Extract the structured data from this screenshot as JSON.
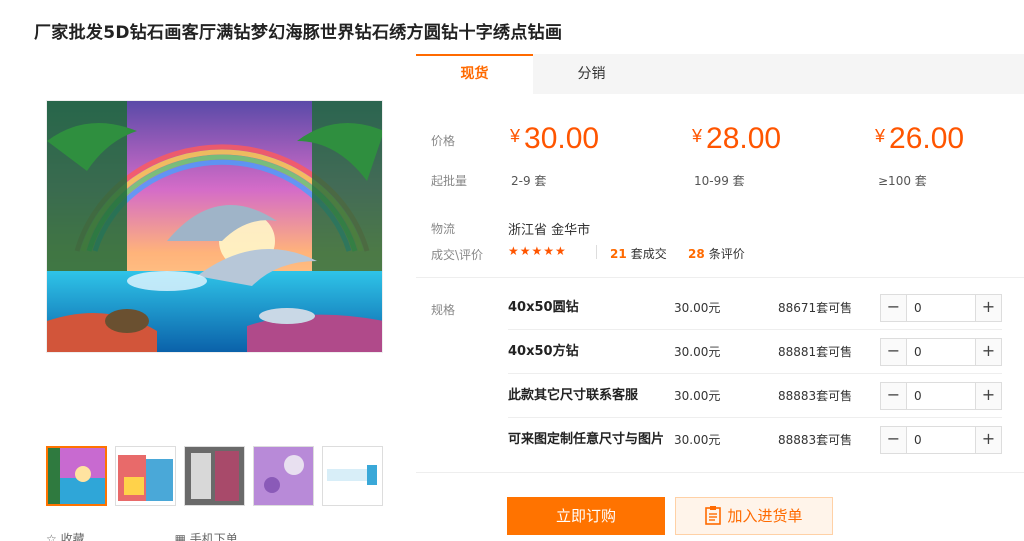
{
  "product": {
    "title": "厂家批发5D钻石画客厅满钻梦幻海豚世界钻石绣方圆钻十字绣点钻画"
  },
  "gallery": {
    "bottom_links": [
      "收藏",
      "手机下单"
    ]
  },
  "tabs": [
    {
      "label": "现货"
    },
    {
      "label": "分销"
    }
  ],
  "pricing": {
    "price_label": "价格",
    "moq_label": "起批量",
    "currency": "¥",
    "tiers": [
      {
        "price": "30.00",
        "range": "2-9 套"
      },
      {
        "price": "28.00",
        "range": "10-99 套"
      },
      {
        "price": "26.00",
        "range": "≥100 套"
      }
    ]
  },
  "logistics": {
    "label": "物流",
    "value": "浙江省 金华市"
  },
  "reviews": {
    "label": "成交\\评价",
    "stars": "★★★★★",
    "deals_count": "21",
    "deals_suffix": "套成交",
    "reviews_count": "28",
    "reviews_suffix": "条评价"
  },
  "specs": {
    "label": "规格",
    "rows": [
      {
        "name": "40x50圆钻",
        "price": "30.00元",
        "stock": "88671套可售",
        "qty": "0"
      },
      {
        "name": "40x50方钻",
        "price": "30.00元",
        "stock": "88881套可售",
        "qty": "0"
      },
      {
        "name": "此款其它尺寸联系客服",
        "price": "30.00元",
        "stock": "88883套可售",
        "qty": "0"
      },
      {
        "name": "可来图定制任意尺寸与图片",
        "price": "30.00元",
        "stock": "88883套可售",
        "qty": "0"
      }
    ]
  },
  "actions": {
    "buy_label": "立即订购",
    "cart_label": "加入进货单"
  },
  "colors": {
    "accent": "#ff6a00",
    "price": "#ff5500"
  }
}
